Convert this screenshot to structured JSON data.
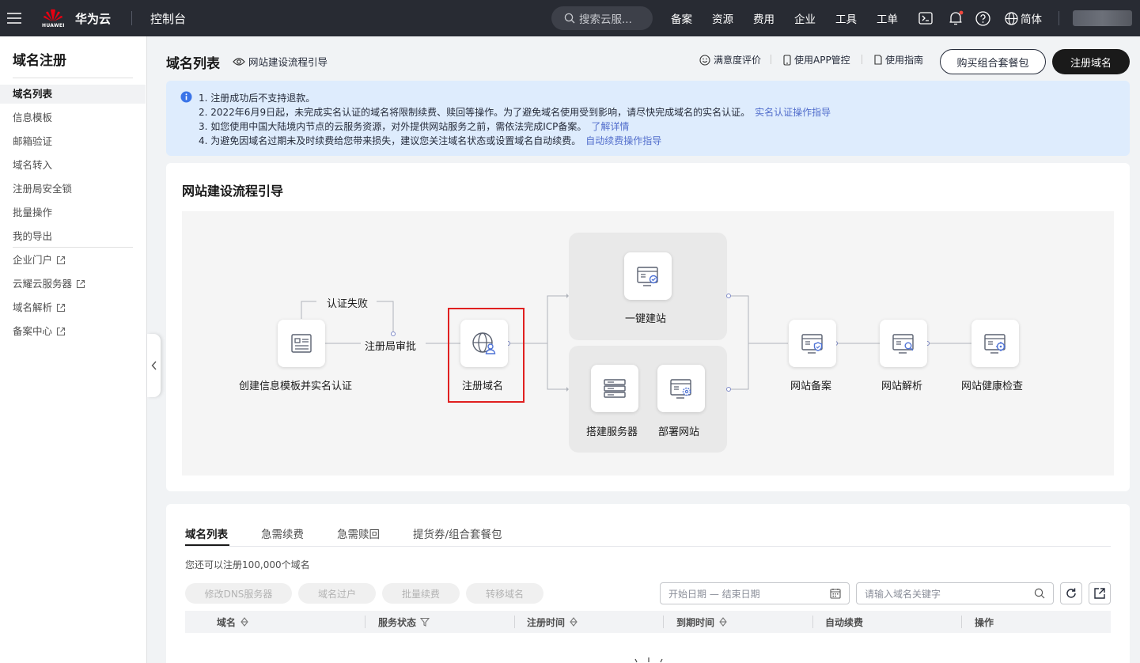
{
  "topbar": {
    "logo_text": "HUAWEI",
    "brand": "华为云",
    "console": "控制台",
    "search_placeholder": "搜索云服...",
    "nav": [
      "备案",
      "资源",
      "费用",
      "企业",
      "工具",
      "工单"
    ],
    "lang": "简体"
  },
  "sidebar": {
    "title": "域名注册",
    "items": [
      {
        "label": "域名列表"
      },
      {
        "label": "信息模板"
      },
      {
        "label": "邮箱验证"
      },
      {
        "label": "域名转入"
      },
      {
        "label": "注册局安全锁"
      },
      {
        "label": "批量操作"
      },
      {
        "label": "我的导出"
      },
      {
        "label": "企业门户"
      },
      {
        "label": "云耀云服务器"
      },
      {
        "label": "域名解析"
      },
      {
        "label": "备案中心"
      }
    ]
  },
  "header": {
    "title": "域名列表",
    "guide_link": "网站建设流程引导",
    "satisfaction": "满意度评价",
    "app": "使用APP管控",
    "guide": "使用指南",
    "buy_package": "购买组合套餐包",
    "register": "注册域名"
  },
  "notice": {
    "lines": [
      {
        "text": "1. 注册成功后不支持退款。",
        "link": ""
      },
      {
        "text": "2. 2022年6月9日起，未完成实名认证的域名将限制续费、赎回等操作。为了避免域名使用受到影响，请尽快完成域名的实名认证。",
        "link": "实名认证操作指导"
      },
      {
        "text": "3. 如您使用中国大陆境内节点的云服务资源，对外提供网站服务之前，需依法完成ICP备案。",
        "link": "了解详情"
      },
      {
        "text": "4. 为避免因域名过期未及时续费给您带来损失，建议您关注域名状态或设置域名自动续费。",
        "link": "自动续费操作指导"
      }
    ]
  },
  "flow": {
    "title": "网站建设流程引导",
    "auth_fail": "认证失败",
    "registry_review": "注册局审批",
    "create_template": "创建信息模板并实名认证",
    "register_domain": "注册域名",
    "one_click_site": "一键建站",
    "build_server": "搭建服务器",
    "deploy_site": "部署网站",
    "site_filing": "网站备案",
    "site_dns": "网站解析",
    "site_health": "网站健康检查"
  },
  "list": {
    "tabs": [
      "域名列表",
      "急需续费",
      "急需赎回",
      "提货券/组合套餐包"
    ],
    "quota_text": "您还可以注册100,000个域名",
    "actions": [
      "修改DNS服务器",
      "域名过户",
      "批量续费",
      "转移域名"
    ],
    "date_placeholder": "开始日期 — 结束日期",
    "search_placeholder": "请输入域名关键字",
    "columns": [
      "域名",
      "服务状态",
      "注册时间",
      "到期时间",
      "自动续费",
      "操作"
    ]
  },
  "colors": {
    "accent": "#526ecc",
    "highlight": "#e02020",
    "topbar": "#282b33"
  }
}
